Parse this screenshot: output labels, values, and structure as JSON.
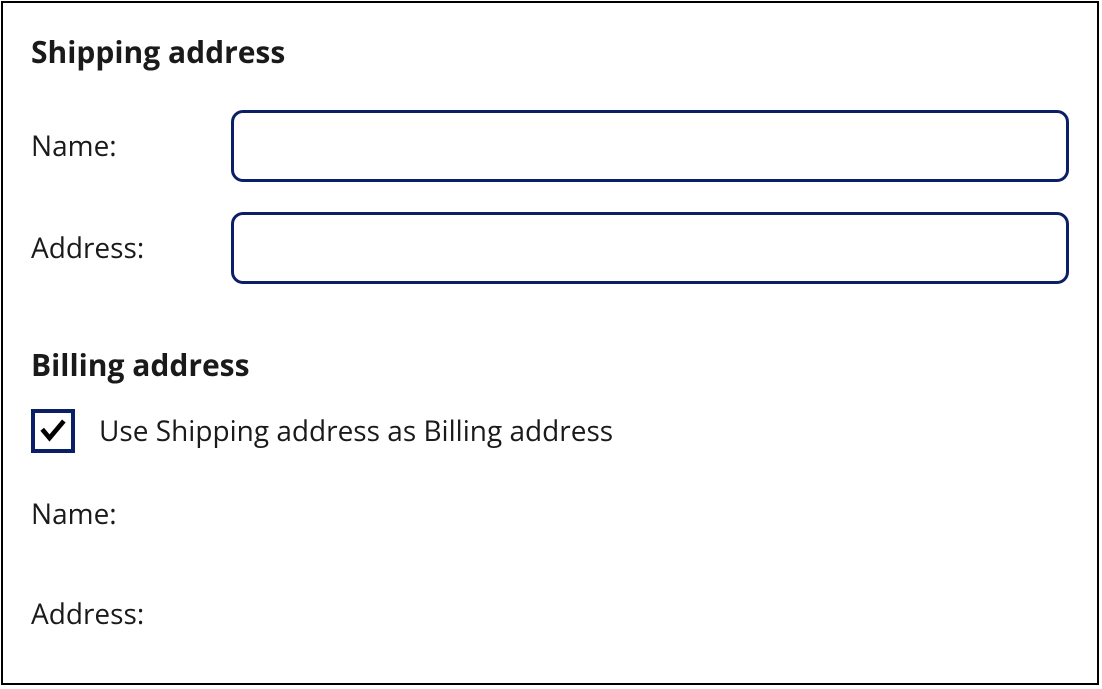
{
  "shipping": {
    "heading": "Shipping address",
    "name_label": "Name:",
    "name_value": "",
    "address_label": "Address:",
    "address_value": ""
  },
  "billing": {
    "heading": "Billing address",
    "use_shipping_label": "Use Shipping address as Billing address",
    "use_shipping_checked": true,
    "name_label": "Name:",
    "address_label": "Address:"
  }
}
